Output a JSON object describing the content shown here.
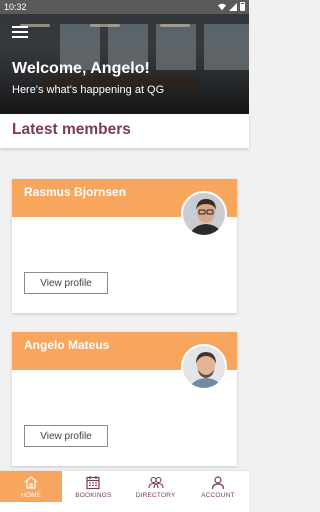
{
  "status_bar": {
    "time": "10:32"
  },
  "hero": {
    "title": "Welcome, Angelo!",
    "subtitle": "Here's what's happening at QG"
  },
  "section": {
    "title": "Latest members"
  },
  "members": [
    {
      "name": "Rasmus Bjornsen",
      "button": "View profile"
    },
    {
      "name": "Angelo Mateus",
      "button": "View profile"
    }
  ],
  "bottom_nav": {
    "items": [
      {
        "label": "HOME",
        "icon": "home-icon",
        "active": true
      },
      {
        "label": "BOOKINGS",
        "icon": "calendar-icon",
        "active": false
      },
      {
        "label": "DIRECTORY",
        "icon": "people-icon",
        "active": false
      },
      {
        "label": "ACCOUNT",
        "icon": "person-icon",
        "active": false
      }
    ]
  },
  "colors": {
    "accent": "#f8a65e",
    "brand": "#7a3d54"
  }
}
